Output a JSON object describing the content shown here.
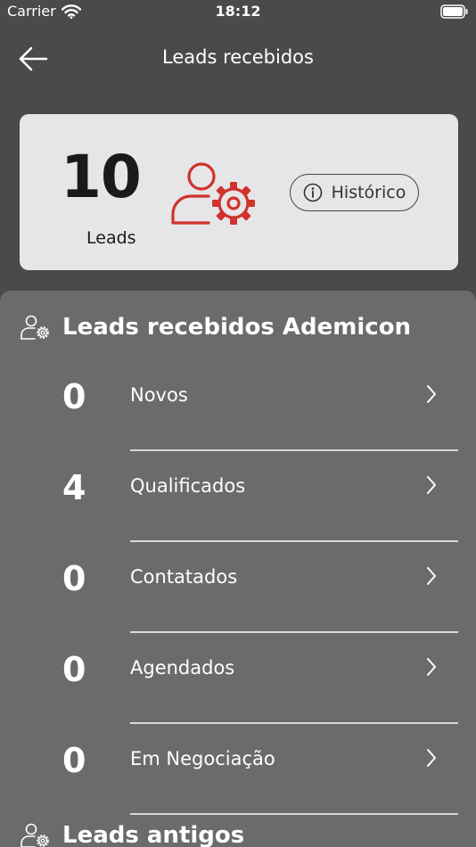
{
  "status_bar": {
    "carrier": "Carrier",
    "time": "18:12"
  },
  "nav": {
    "title": "Leads recebidos"
  },
  "summary": {
    "count": "10",
    "count_label": "Leads",
    "history_label": "Histórico"
  },
  "section_received": {
    "title": "Leads recebidos Ademicon",
    "rows": [
      {
        "count": "0",
        "label": "Novos"
      },
      {
        "count": "4",
        "label": "Qualificados"
      },
      {
        "count": "0",
        "label": "Contatados"
      },
      {
        "count": "0",
        "label": "Agendados"
      },
      {
        "count": "0",
        "label": "Em Negociação"
      }
    ]
  },
  "section_old": {
    "title": "Leads antigos"
  },
  "colors": {
    "accent": "#d0322c",
    "background": "#4a4a4a",
    "sheet": "#6b6b6b",
    "card": "#e6e6e8"
  },
  "icons": [
    "wifi-icon",
    "battery-icon",
    "back-arrow-icon",
    "user-gear-icon",
    "info-icon",
    "chevron-right-icon"
  ]
}
